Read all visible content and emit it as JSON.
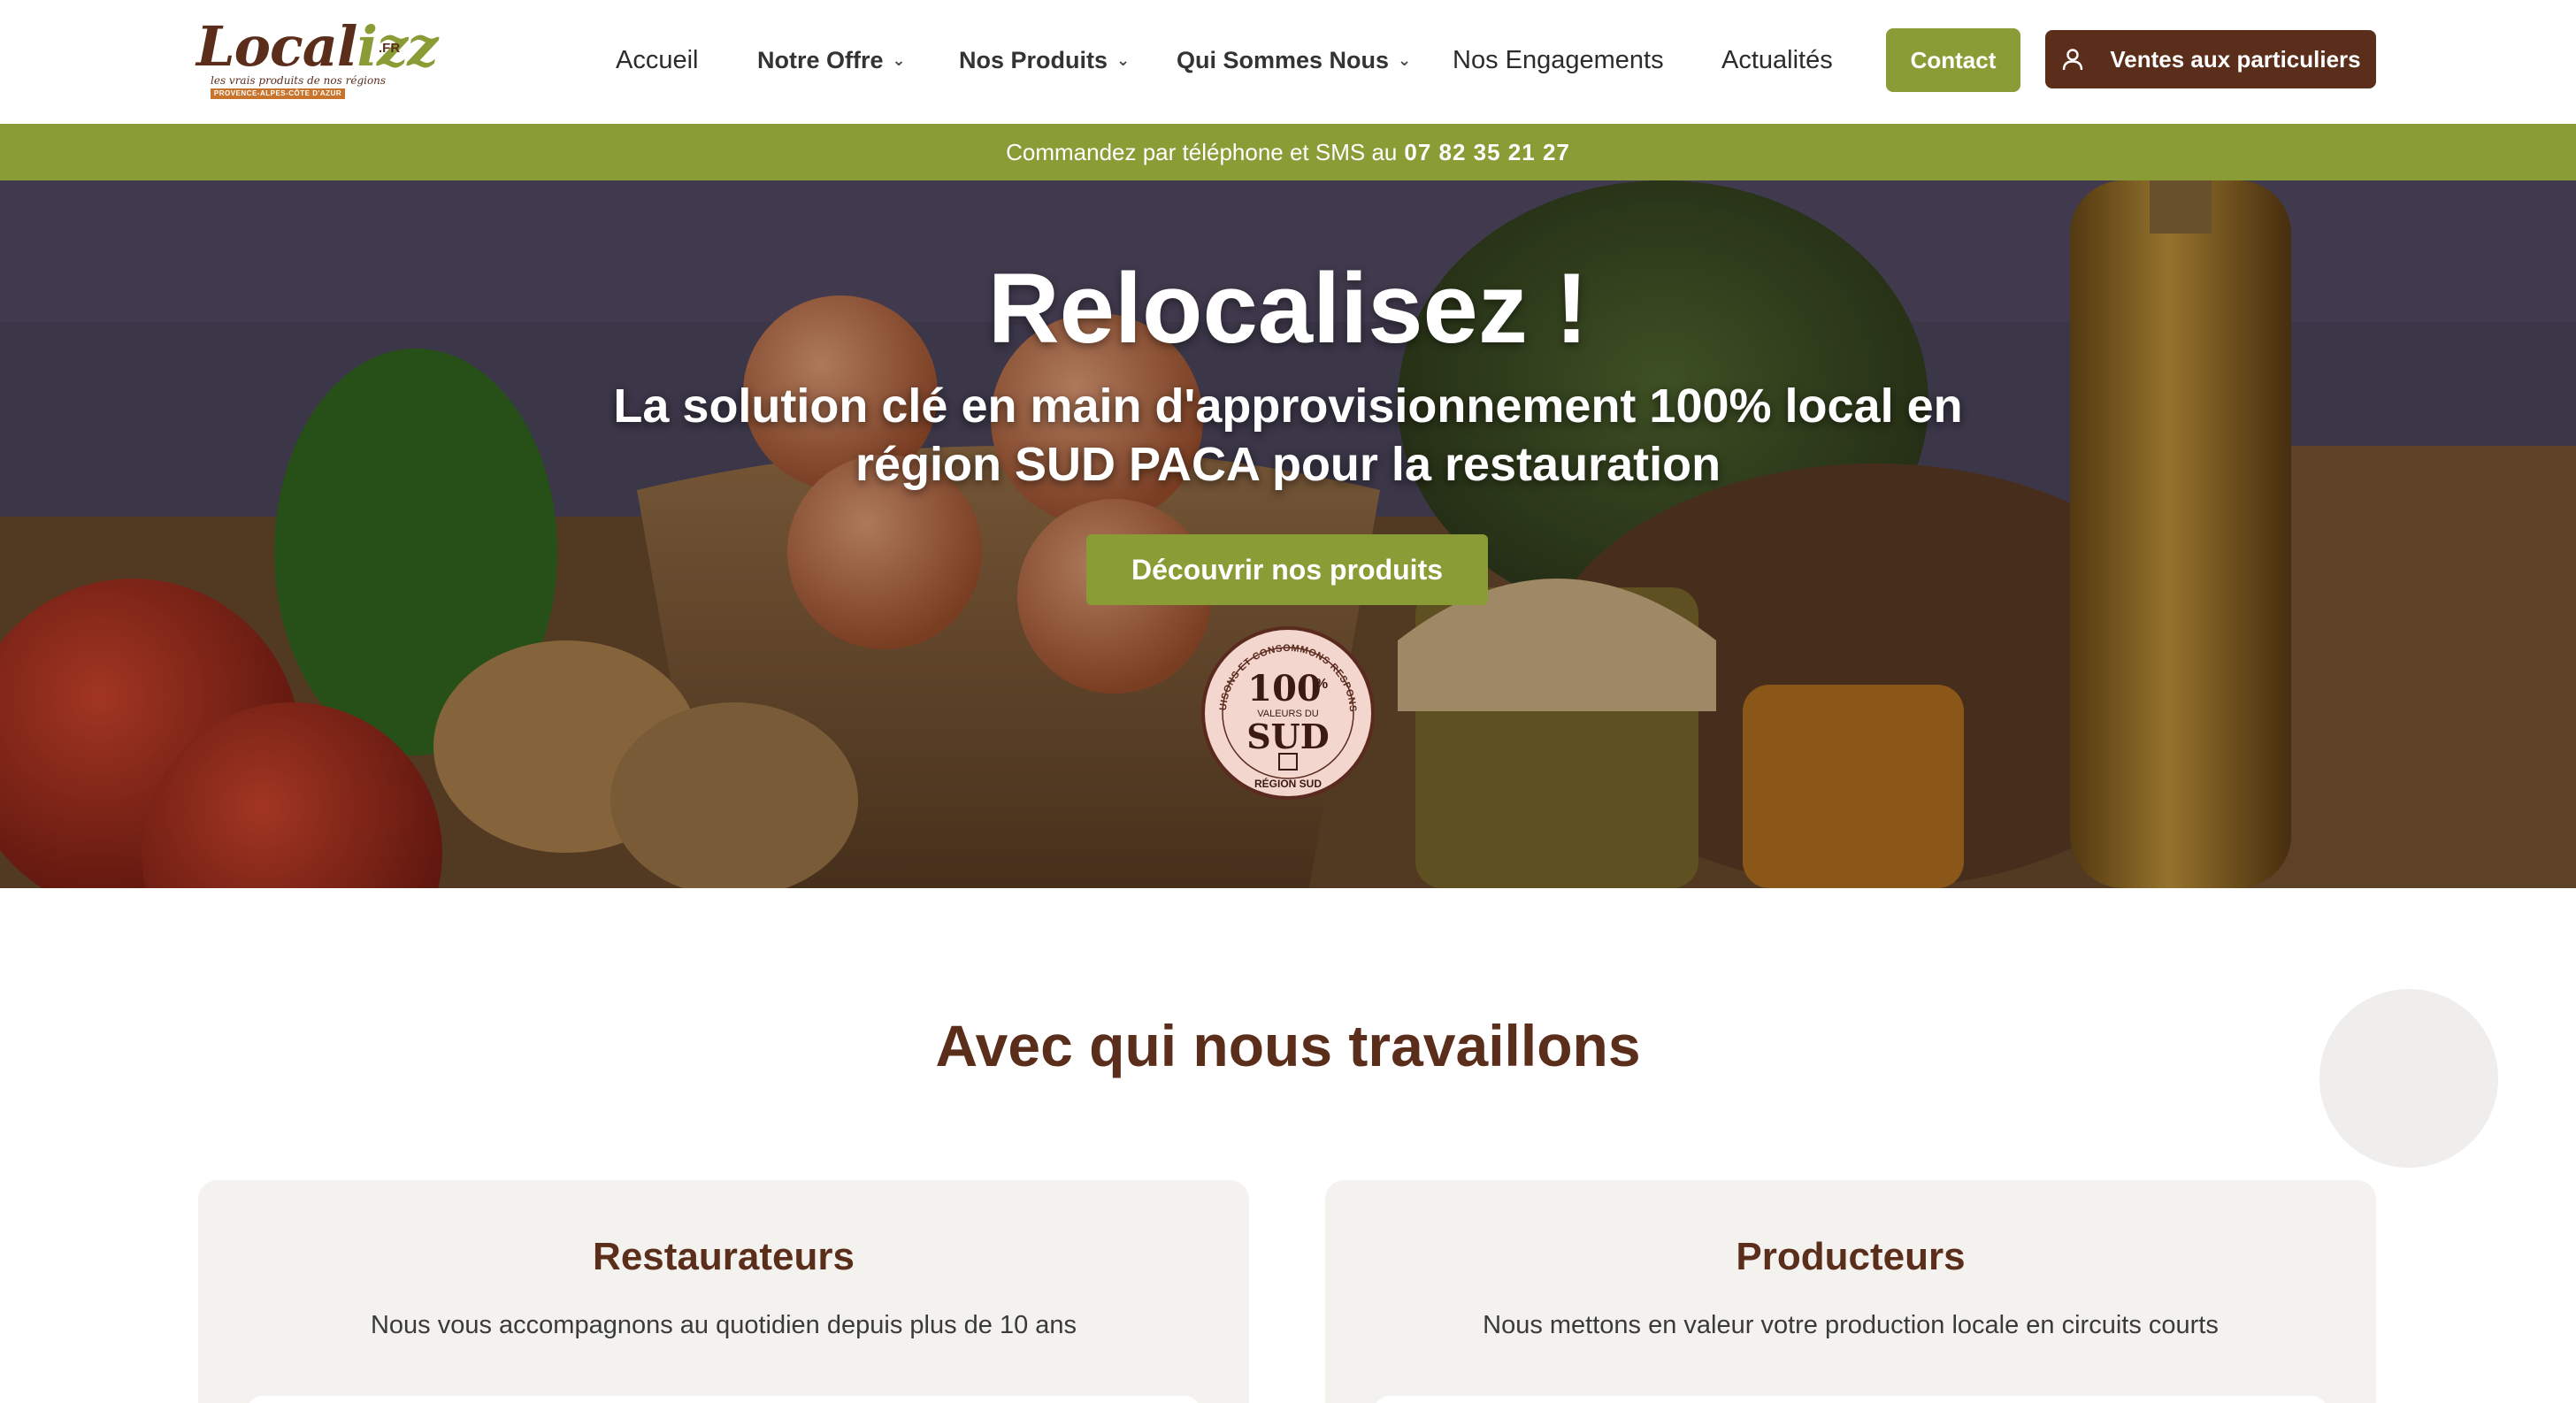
{
  "header": {
    "logo": {
      "word_part1": "Local",
      "word_part2": "izz",
      "suffix": ".FR",
      "tagline": "les vrais produits de nos régions",
      "region": "PROVENCE-ALPES-CÔTE D'AZUR"
    },
    "nav": [
      {
        "label": "Accueil",
        "dropdown": false
      },
      {
        "label": "Notre Offre",
        "dropdown": true
      },
      {
        "label": "Nos Produits",
        "dropdown": true
      },
      {
        "label": "Qui Sommes Nous",
        "dropdown": true
      },
      {
        "label": "Nos Engagements",
        "dropdown": false
      },
      {
        "label": "Actualités",
        "dropdown": false
      }
    ],
    "contact_label": "Contact",
    "ventes_label": "Ventes aux particuliers",
    "ventes_icon": "user-icon"
  },
  "promo": {
    "text": "Commandez par téléphone et SMS au",
    "phone": "07 82 35 21 27"
  },
  "hero": {
    "title": "Relocalisez !",
    "subtitle": "La solution clé en main d'approvisionnement 100% local en région SUD PACA pour la restauration",
    "cta_label": "Découvrir nos produits",
    "badge": {
      "arc_text": "PRODUISONS ET CONSOMMONS RESPONSABLE",
      "number": "100",
      "percent": "%",
      "middle": "VALEURS DU",
      "big": "SUD",
      "bottom": "RÉGION SUD"
    }
  },
  "section": {
    "title": "Avec qui nous travaillons",
    "cards": [
      {
        "title": "Restaurateurs",
        "text": "Nous vous accompagnons au quotidien depuis plus de 10 ans"
      },
      {
        "title": "Producteurs",
        "text": "Nous mettons en valeur votre production locale en circuits courts"
      }
    ]
  },
  "colors": {
    "brand_green": "#8a9c36",
    "brand_brown": "#5b2e1c",
    "card_bg": "#f4f2ef"
  }
}
